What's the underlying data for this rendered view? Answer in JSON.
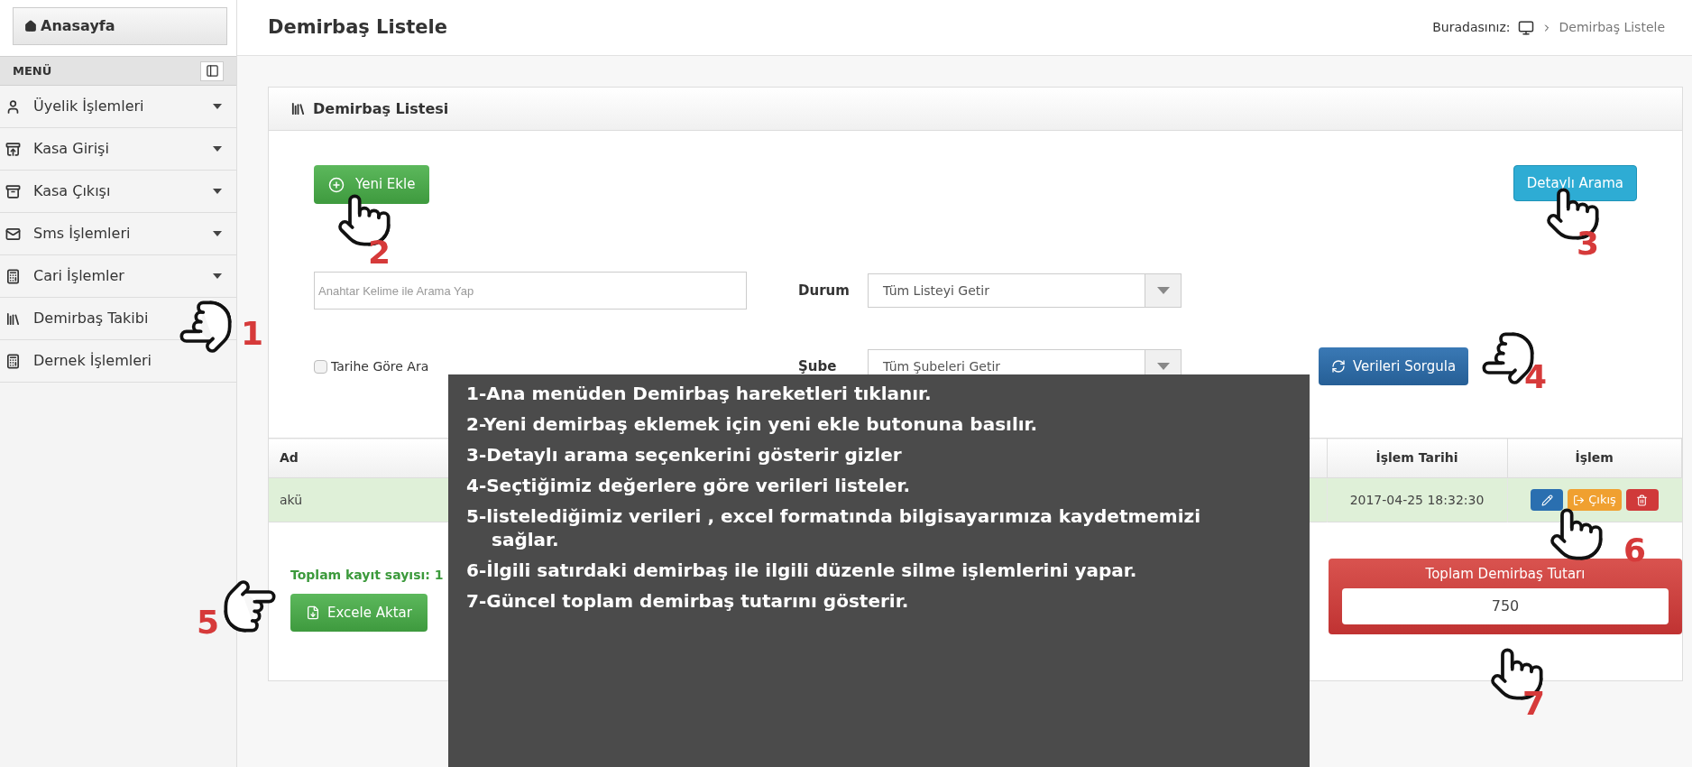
{
  "sidebar": {
    "home_button": "Anasayfa",
    "menu_title": "MENÜ",
    "items": [
      {
        "label": "Üyelik İşlemleri",
        "kind": "user",
        "expandable": true
      },
      {
        "label": "Kasa Girişi",
        "kind": "box-in",
        "expandable": true
      },
      {
        "label": "Kasa Çıkışı",
        "kind": "box-out",
        "expandable": true
      },
      {
        "label": "Sms İşlemleri",
        "kind": "mail",
        "expandable": true
      },
      {
        "label": "Cari İşlemler",
        "kind": "calculator",
        "expandable": true
      },
      {
        "label": "Demirbaş Takibi",
        "kind": "binders",
        "expandable": false
      },
      {
        "label": "Dernek İşlemleri",
        "kind": "calculator",
        "expandable": false
      }
    ]
  },
  "header": {
    "title": "Demirbaş Listele",
    "breadcrumb_label": "Buradasınız:",
    "breadcrumb_current": "Demirbaş Listele"
  },
  "panel": {
    "title": "Demirbaş Listesi",
    "add_button": "Yeni Ekle",
    "detail_search_button": "Detaylı Arama",
    "search": {
      "placeholder": "Anahtar Kelime ile Arama Yap"
    },
    "date_filter": {
      "label": "Tarihe Göre Ara",
      "checked": false
    },
    "filters": [
      {
        "label": "Durum",
        "value": "Tüm Listeyi Getir"
      },
      {
        "label": "Şube",
        "value": "Tüm Şubeleri Getir"
      }
    ],
    "query_button": "Verileri Sorgula",
    "table": {
      "columns": [
        "Ad",
        null,
        null,
        null,
        null,
        null,
        null,
        null,
        null,
        "İşlem Tarihi",
        "İşlem"
      ],
      "rows": [
        {
          "selected": true,
          "cells": [
            "akü",
            null,
            null,
            null,
            null,
            null,
            null,
            null,
            null,
            "2017-04-25 18:32:30"
          ],
          "actions": [
            {
              "kind": "edit"
            },
            {
              "kind": "exit",
              "label": "Çıkış"
            },
            {
              "kind": "delete"
            }
          ]
        }
      ]
    },
    "record_count": "Toplam kayıt sayısı: 1",
    "export_button": "Excele Aktar",
    "total": {
      "label": "Toplam Demirbaş Tutarı",
      "value": "750"
    }
  },
  "annotations": {
    "steps": [
      "1-Ana menüden Demirbaş hareketleri tıklanır.",
      "2-Yeni demirbaş eklemek için yeni ekle butonuna basılır.",
      "3-Detaylı arama seçenkerini gösterir gizler",
      "4-Seçtiğimiz değerlere göre verileri listeler.",
      "5-listelediğimiz verileri , excel formatında bilgisayarımıza kaydetmemizi sağlar.",
      "6-İlgili satırdaki demirbaş ile ilgili düzenle silme işlemlerini yapar.",
      "7-Güncel toplam demirbaş tutarını gösterir."
    ],
    "markers": [
      "1",
      "2",
      "3",
      "4",
      "5",
      "6",
      "7"
    ]
  }
}
